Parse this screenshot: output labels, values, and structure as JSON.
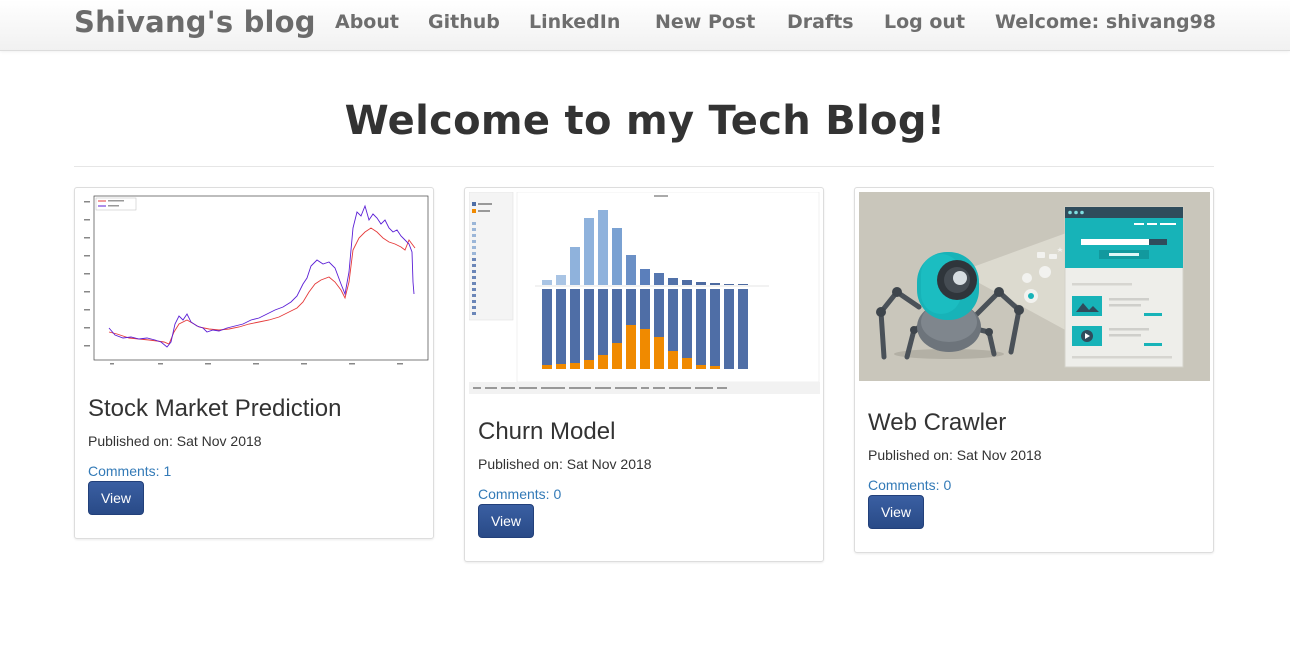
{
  "navbar": {
    "brand": "Shivang's blog",
    "links": [
      {
        "label": "About"
      },
      {
        "label": "Github"
      },
      {
        "label": "LinkedIn"
      },
      {
        "label": "New Post"
      },
      {
        "label": "Drafts"
      },
      {
        "label": "Log out"
      }
    ],
    "welcome": "Welcome: shivang98"
  },
  "header": {
    "title": "Welcome to my Tech Blog!"
  },
  "posts": [
    {
      "title": "Stock Market Prediction",
      "published": "Published on: Sat Nov 2018",
      "comments": "Comments: 1",
      "view_label": "View",
      "image": "line-chart-thumbnail"
    },
    {
      "title": "Churn Model",
      "published": "Published on: Sat Nov 2018",
      "comments": "Comments: 0",
      "view_label": "View",
      "image": "bar-chart-dashboard-thumbnail"
    },
    {
      "title": "Web Crawler",
      "published": "Published on: Sat Nov 2018",
      "comments": "Comments: 0",
      "view_label": "View",
      "image": "robot-spider-crawler-illustration"
    }
  ],
  "colors": {
    "link": "#337ab7",
    "button": "#2f5596",
    "nav_text": "#6e6e6e",
    "crawler_bg": "#c9c6bb",
    "crawler_teal": "#17b3b8"
  }
}
